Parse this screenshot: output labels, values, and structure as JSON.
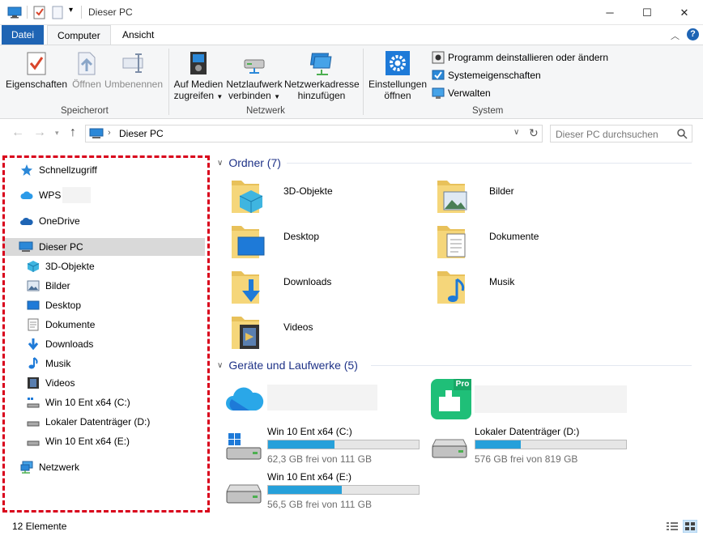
{
  "window": {
    "title": "Dieser PC",
    "minimize_glyph": "─",
    "maximize_glyph": "☐",
    "close_glyph": "✕"
  },
  "tabs": [
    {
      "label": "Datei"
    },
    {
      "label": "Computer"
    },
    {
      "label": "Ansicht"
    }
  ],
  "ribbon": {
    "location_group": {
      "label": "Speicherort",
      "buttons": [
        {
          "label": "Eigenschaften",
          "enabled": true,
          "icon": "properties-icon"
        },
        {
          "label": "Öffnen",
          "enabled": false,
          "icon": "open-icon"
        },
        {
          "label": "Umbenennen",
          "enabled": false,
          "icon": "rename-icon"
        }
      ]
    },
    "network_group": {
      "label": "Netzwerk",
      "buttons": [
        {
          "line1": "Auf Medien",
          "line2": "zugreifen",
          "dropdown": true,
          "icon": "media-icon"
        },
        {
          "line1": "Netzlaufwerk",
          "line2": "verbinden",
          "dropdown": true,
          "icon": "network-drive-icon"
        },
        {
          "line1": "Netzwerkadresse",
          "line2": "hinzufügen",
          "dropdown": false,
          "icon": "network-location-icon"
        }
      ]
    },
    "system_group": {
      "label": "System",
      "settings_line1": "Einstellungen",
      "settings_line2": "öffnen",
      "small_buttons": [
        {
          "label": "Programm deinstallieren oder ändern",
          "icon": "uninstall-icon"
        },
        {
          "label": "Systemeigenschaften",
          "icon": "system-properties-icon"
        },
        {
          "label": "Verwalten",
          "icon": "manage-icon"
        }
      ]
    }
  },
  "address": {
    "path": "Dieser PC",
    "search_placeholder": "Dieser PC durchsuchen"
  },
  "sidebar": {
    "items": [
      {
        "label": "Schnellzugriff",
        "icon": "star-icon"
      },
      {
        "label": "WPS",
        "icon": "cloud-icon"
      },
      {
        "label": "OneDrive",
        "icon": "onedrive-icon"
      },
      {
        "label": "Dieser PC",
        "icon": "computer-icon"
      },
      {
        "label": "3D-Objekte",
        "icon": "3d-objects-icon"
      },
      {
        "label": "Bilder",
        "icon": "pictures-icon"
      },
      {
        "label": "Desktop",
        "icon": "desktop-icon"
      },
      {
        "label": "Dokumente",
        "icon": "documents-icon"
      },
      {
        "label": "Downloads",
        "icon": "downloads-icon"
      },
      {
        "label": "Musik",
        "icon": "music-icon"
      },
      {
        "label": "Videos",
        "icon": "videos-icon"
      },
      {
        "label": "Win 10 Ent x64 (C:)",
        "icon": "drive-icon"
      },
      {
        "label": "Lokaler Datenträger (D:)",
        "icon": "drive-icon"
      },
      {
        "label": "Win 10 Ent x64 (E:)",
        "icon": "drive-icon"
      },
      {
        "label": "Netzwerk",
        "icon": "network-icon"
      }
    ]
  },
  "content": {
    "folders_header": "Ordner (7)",
    "folders": [
      {
        "label": "3D-Objekte",
        "icon": "3d-objects-icon"
      },
      {
        "label": "Bilder",
        "icon": "pictures-icon"
      },
      {
        "label": "Desktop",
        "icon": "desktop-icon"
      },
      {
        "label": "Dokumente",
        "icon": "documents-icon"
      },
      {
        "label": "Downloads",
        "icon": "downloads-icon"
      },
      {
        "label": "Musik",
        "icon": "music-icon"
      },
      {
        "label": "Videos",
        "icon": "videos-icon"
      }
    ],
    "drives_header": "Geräte und Laufwerke (5)",
    "pro_badge": "Pro",
    "drives": [
      {
        "name": "Win 10 Ent x64 (C:)",
        "free": "62,3 GB frei von 111 GB",
        "used_fraction": 0.44
      },
      {
        "name": "Lokaler Datenträger (D:)",
        "free": "576 GB frei von 819 GB",
        "used_fraction": 0.3
      },
      {
        "name": "Win 10 Ent x64 (E:)",
        "free": "56,5 GB frei von 111 GB",
        "used_fraction": 0.49
      }
    ]
  },
  "status": {
    "count": "12 Elemente"
  },
  "colors": {
    "accent": "#1e64b4",
    "selection": "#d9d9d9",
    "highlight_border": "#d9001b",
    "drive_bar": "#26a0da",
    "section_header": "#1e3287"
  }
}
